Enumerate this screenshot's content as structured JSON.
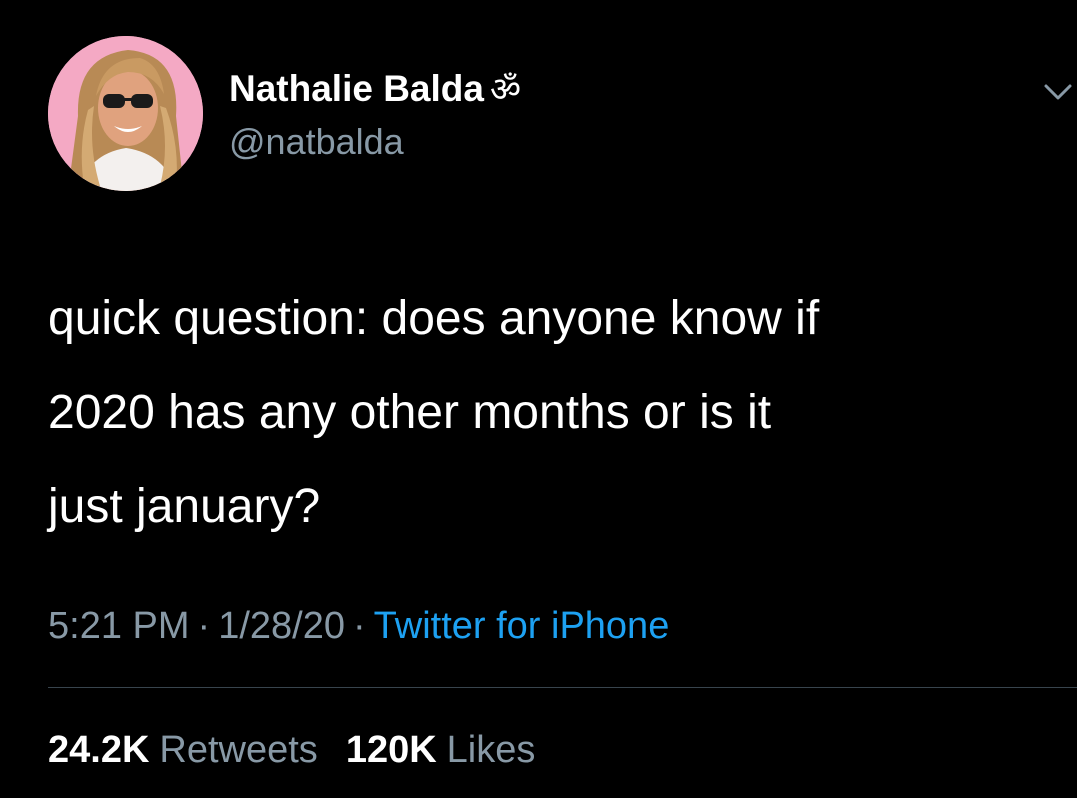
{
  "author": {
    "display_name": "Nathalie Balda",
    "name_emoji": "ॐ",
    "handle": "@natbalda"
  },
  "tweet": {
    "text": "quick question: does anyone know if\n2020 has any other months or is it\njust january?"
  },
  "meta": {
    "time": "5:21 PM",
    "separator": "·",
    "date": "1/28/20",
    "source": "Twitter for iPhone"
  },
  "stats": {
    "retweets_count": "24.2K",
    "retweets_label": "Retweets",
    "likes_count": "120K",
    "likes_label": "Likes"
  },
  "icons": {
    "caret": "chevron-down-icon"
  },
  "colors": {
    "background": "#000000",
    "primary_text": "#ffffff",
    "secondary_text": "#8899a6",
    "link": "#1da1f2",
    "divider": "#38444d"
  }
}
